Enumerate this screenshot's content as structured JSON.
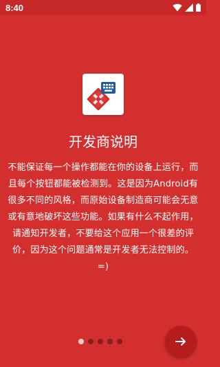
{
  "status_bar": {
    "time": "8:40",
    "icons": [
      "wifi-icon",
      "signal-icon",
      "battery-icon"
    ]
  },
  "intro": {
    "app_icon": "gamepad-keyboard-app-icon",
    "title": "开发商说明",
    "description": "不能保证每一个操作都能在你的设备上运行，而且每个按钮都能被检测到。这是因为Android有很多不同的风格，而原始设备制造商可能会无意或有意地破坏这些功能。如果有什么不起作用，请通知开发者，不要给这个应用一个很差的评价，因为这个问题通常是开发者无法控制的。=)"
  },
  "pager": {
    "total_pages": 5,
    "current_page": 1,
    "next_icon": "arrow-right-icon"
  },
  "colors": {
    "background": "#d32f2f",
    "status_bar": "#c62828",
    "next_button": "#b71c1c",
    "icon_red": "#d32f2f",
    "icon_blue": "#1e5aa8"
  }
}
